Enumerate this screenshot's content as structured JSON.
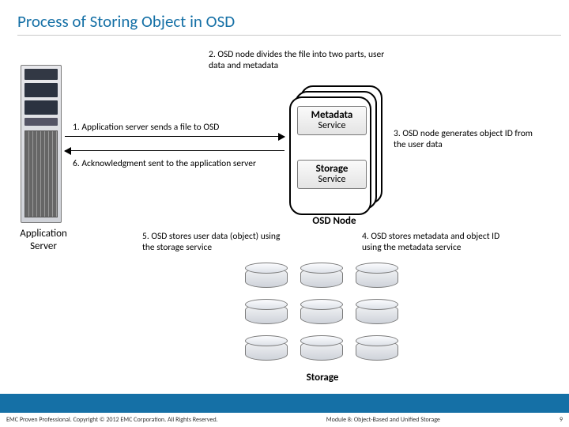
{
  "title": "Process of Storing Object in OSD",
  "labels": {
    "app_server": "Application Server",
    "osd_node": "OSD Node",
    "storage": "Storage"
  },
  "services": {
    "metadata_title": "Metadata",
    "metadata_sub": "Service",
    "storage_title": "Storage",
    "storage_sub": "Service"
  },
  "steps": {
    "s1": "1. Application server sends a file to OSD",
    "s2": "2. OSD node divides the file into two parts, user data and metadata",
    "s3": "3. OSD node generates object ID from the user data",
    "s4": "4. OSD stores metadata and object ID using the metadata service",
    "s5": "5. OSD stores user data (object) using the storage service",
    "s6": "6. Acknowledgment sent to the application server"
  },
  "footer": {
    "left": "EMC Proven Professional. Copyright © 2012 EMC Corporation. All Rights Reserved.",
    "right": "Module 8: Object-Based and Unified Storage",
    "page": "9"
  }
}
